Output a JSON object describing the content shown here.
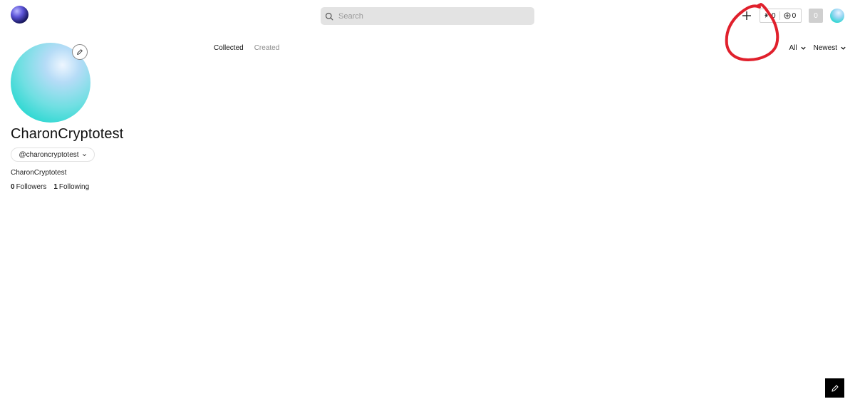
{
  "header": {
    "search_placeholder": "Search",
    "counter_a": "0",
    "counter_b": "0",
    "badge_count": "0"
  },
  "profile": {
    "name": "CharonCryptotest",
    "handle": "@charoncryptotest",
    "bio": "CharonCryptotest",
    "followers_count": "0",
    "followers_label": "Followers",
    "following_count": "1",
    "following_label": "Following"
  },
  "tabs": [
    {
      "label": "Collected",
      "active": true
    },
    {
      "label": "Created",
      "active": false
    }
  ],
  "filters": {
    "type": "All",
    "sort": "Newest"
  },
  "colors": {
    "annotation": "#e0202c",
    "avatar_accent": "#2fd8d2",
    "fab_background": "#000000"
  },
  "icons": [
    "logo",
    "search-icon",
    "plus-icon",
    "sparkle-icon",
    "plus-circle-icon",
    "pencil-icon",
    "chevron-down-icon"
  ]
}
